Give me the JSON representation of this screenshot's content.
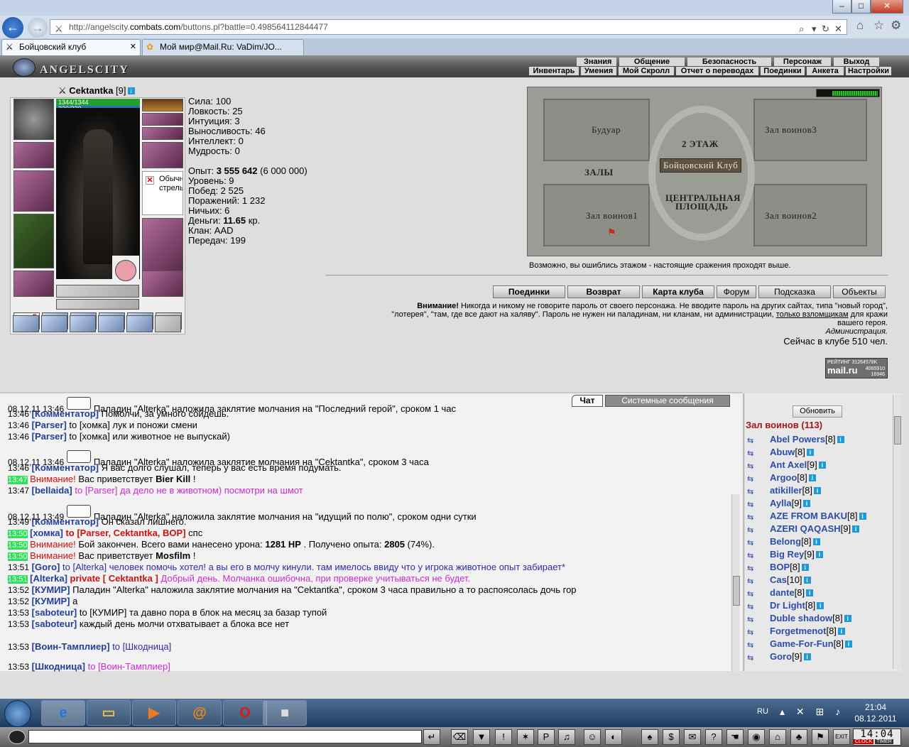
{
  "browser": {
    "address_prefix": "http://angelscity.",
    "address_domain": "combats.com",
    "address_rest": "/buttons.pl?battle=0.498564112844477",
    "tabs": [
      "Бойцовский клуб",
      "Мой мир@Mail.Ru: VaDim/JO..."
    ]
  },
  "site": {
    "logo": "ANGELSCITY",
    "menu_top": [
      "Знания",
      "Общение",
      "Безопасность",
      "Персонаж",
      "Выход"
    ],
    "menu_bottom": [
      "Инвентарь",
      "Умения",
      "Мой Скролл",
      "Отчет о переводах",
      "Поединки",
      "Анкета",
      "Настройки"
    ]
  },
  "character": {
    "name": "Cektantka",
    "level": "[9]",
    "hp": "1344/1344",
    "mp": "320/320",
    "arrows_label": "Обычные стрелы",
    "potion_count": "5",
    "stats": [
      {
        "label": "Сила:",
        "value": "100"
      },
      {
        "label": "Ловкость:",
        "value": "25"
      },
      {
        "label": "Интуиция:",
        "value": "3"
      },
      {
        "label": "Выносливость:",
        "value": "46"
      },
      {
        "label": "Интеллект:",
        "value": "0"
      },
      {
        "label": "Мудрость:",
        "value": "0"
      }
    ],
    "experience_label": "Опыт:",
    "experience_value": "3 555 642",
    "experience_next": "(6 000 000)",
    "level_line": "Уровень: 9",
    "wins_line": "Побед: 2 525",
    "losses_line": "Поражений: 1 232",
    "draws_line": "Ничьих: 6",
    "money_label": "Деньги:",
    "money_value": "11.65",
    "money_unit": "кр.",
    "clan_line": "Клан: AAD",
    "transfers_line": "Передач: 199"
  },
  "map": {
    "labels": {
      "boudoir": "Будуар",
      "hall3": "Зал воинов3",
      "floor2": "2 ЭТАЖ",
      "club": "Бойцовский Клуб",
      "halls": "ЗАЛЫ",
      "central1": "ЦЕНТРАЛЬНАЯ",
      "central2": "ПЛОЩАДЬ",
      "hall1": "Зал воинов1",
      "hall2": "Зал воинов2"
    },
    "note": "Возможно, вы ошиблись этажом - настоящие сражения проходят выше."
  },
  "actions": [
    "Поединки",
    "Возврат",
    "Карта клуба",
    "Форум",
    "Подсказка",
    "Объекты"
  ],
  "warning": {
    "title": "Внимание!",
    "text1": "Никогда и никому не говорите пароль от своего персонажа. Не вводите пароль на других сайтах, типа \"новый город\",",
    "text2a": "\"лотерея\", \"там, где все дают на халяву\". Пароль не нужен ни паладинам, ни кланам, ни администрации,",
    "text2link": "только взломщикам",
    "text2b": "для кражи",
    "text3": "вашего героя.",
    "admin": "Администрация.",
    "online": "Сейчас в клубе 510 чел."
  },
  "rating": {
    "label": "РЕЙТИНГ",
    "top": "31264578K",
    "n1": "4065910",
    "n2": "16946",
    "brand": "mail.ru"
  },
  "chat_tabs": [
    "Чат",
    "Системные сообщения"
  ],
  "chat": [
    {
      "t": "08,12,11 13:46",
      "seal": true,
      "text": "Паладин \"Alterka\" наложила заклятие молчания на \"Последний герой\", сроком 1 час"
    },
    {
      "t": "13:46",
      "nick": "[Комментатор]",
      "text": "Помолчи, за умного сойдешь."
    },
    {
      "t": "13:46",
      "nick": "[Parser]",
      "text": "to [хомка] лук и поножи смени"
    },
    {
      "t": "13:46",
      "nick": "[Parser]",
      "text": "to [хомка] или животное не выпускай)"
    },
    {
      "t": "08,12,11 13:46",
      "seal": true,
      "text": "Паладин \"Alterka\" наложила заклятие молчания на \"Cektantka\", сроком 3 часа"
    },
    {
      "t": "13:46",
      "nick": "[Комментатор]",
      "text": "Я вас долго слушал, теперь у вас есть время подумать."
    },
    {
      "t": "13:47",
      "green": true,
      "sys": "Внимание!",
      "text": "Вас приветствует",
      "bold": "Bier Kill",
      "tail": "!"
    },
    {
      "t": "13:47",
      "nick": "[bellaida]",
      "mag": "to [Parser] да дело не в животном) посмотри на шмот"
    },
    {
      "t": "08,12,11 13:49",
      "seal": true,
      "text": "Паладин \"Alterka\" наложила заклятие молчания на \"идущий по полю\", сроком одни сутки"
    },
    {
      "t": "13:49",
      "nick": "[Комментатор]",
      "text": "Он сказал лишнего."
    },
    {
      "t": "13:50",
      "green": true,
      "nick": "[хомка]",
      "redb": "to [Parser, Cektantka, BOP]",
      "text": "спс"
    },
    {
      "t": "13:50",
      "green": true,
      "sys": "Внимание!",
      "text": "Бой закончен. Всего вами нанесено урона:",
      "bold": "1281 HP",
      "tail": ". Получено опыта:",
      "bold2": "2805",
      "tail2": "(74%)."
    },
    {
      "t": "13:50",
      "green": true,
      "sys": "Внимание!",
      "text": "Вас приветствует",
      "bold": "Mosfilm",
      "tail": "!"
    },
    {
      "t": "13:51",
      "nick": "[Goro]",
      "blu": "to [Alterka] человек помочь хотел! а вы его в молчу кинули. там имелось ввиду что у игрока животное опыт забирает*"
    },
    {
      "t": "13:51",
      "green": true,
      "nick": "[Alterka]",
      "redb": "private [ Cektantka ]",
      "mag": "Добрый день. Молчанка ошибочна, при проверке учитываться не будет."
    },
    {
      "t": "13:52",
      "nick": "[КУМИР]",
      "text": "Паладин \"Alterka\" наложила заклятие молчания на \"Cektantka\", сроком 3 часа правильно а то распоясолась дочь гор"
    },
    {
      "t": "13:52",
      "nick": "[КУМИР]",
      "text": "а"
    },
    {
      "t": "13:53",
      "nick": "[saboteur]",
      "text": "to [КУМИР] та давно пора в блок на месяц за базар тупой"
    },
    {
      "t": "13:53",
      "nick": "[saboteur]",
      "text": "каждый день молчи отхватывает а блока все нет"
    },
    {
      "t": "13:53",
      "nick": "[Воин-Тамплиер]",
      "blu": "to [Шкодница]"
    },
    {
      "t": "13:53",
      "nick": "[Шкодница]",
      "mag": "to [Воин-Тамплиер]"
    }
  ],
  "online": {
    "refresh": "Обновить",
    "room": "Зал воинов (113)",
    "users": [
      {
        "name": "Abel Powers",
        "lv": "[8]"
      },
      {
        "name": "Abuw",
        "lv": "[8]"
      },
      {
        "name": "Ant Axel",
        "lv": "[9]"
      },
      {
        "name": "Argoo",
        "lv": "[8]"
      },
      {
        "name": "atikiller",
        "lv": "[8]"
      },
      {
        "name": "Aylla",
        "lv": "[9]"
      },
      {
        "name": "AZE FROM BAKU",
        "lv": "[8]"
      },
      {
        "name": "AZERI QAQASH",
        "lv": "[9]"
      },
      {
        "name": "Belong",
        "lv": "[8]"
      },
      {
        "name": "Big Rey",
        "lv": "[9]"
      },
      {
        "name": "BOP",
        "lv": "[8]"
      },
      {
        "name": "Cas",
        "lv": "[10]"
      },
      {
        "name": "dante",
        "lv": "[8]"
      },
      {
        "name": "Dr Light",
        "lv": "[8]"
      },
      {
        "name": "Duble shadow",
        "lv": "[8]"
      },
      {
        "name": "Forgetmenot",
        "lv": "[8]"
      },
      {
        "name": "Game-For-Fun",
        "lv": "[8]"
      },
      {
        "name": "Goro",
        "lv": "[9]"
      }
    ]
  },
  "bottom": {
    "clock": "14:04",
    "clock_label": "CLOCK",
    "timer_label": "TIMER"
  },
  "taskbar": {
    "lang": "RU",
    "time": "21:04",
    "date": "08.12.2011"
  }
}
